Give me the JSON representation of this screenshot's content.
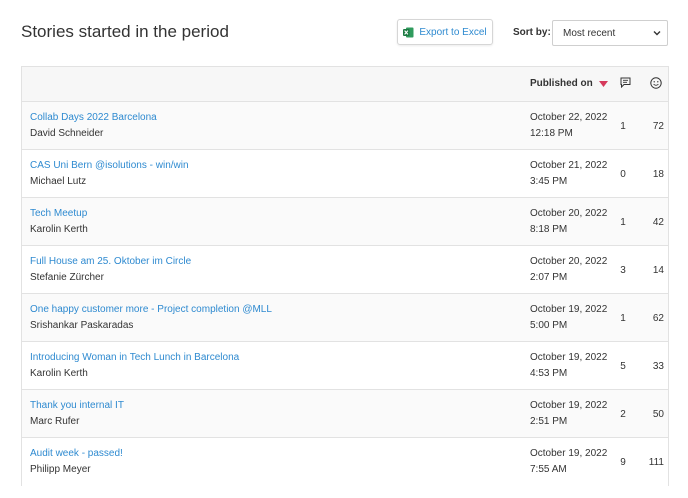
{
  "header": {
    "title": "Stories started in the period",
    "export_label": "Export to Excel",
    "sort_label": "Sort by:",
    "sort_selected": "Most recent"
  },
  "table": {
    "col_published": "Published on",
    "rows": [
      {
        "title": "Collab Days 2022 Barcelona",
        "author": "David Schneider",
        "date": "October 22, 2022",
        "time": "12:18 PM",
        "comments": "1",
        "reactions": "72"
      },
      {
        "title": "CAS Uni Bern @isolutions - win/win",
        "author": "Michael Lutz",
        "date": "October 21, 2022",
        "time": "3:45 PM",
        "comments": "0",
        "reactions": "18"
      },
      {
        "title": "Tech Meetup",
        "author": "Karolin Kerth",
        "date": "October 20, 2022",
        "time": "8:18 PM",
        "comments": "1",
        "reactions": "42"
      },
      {
        "title": "Full House am 25. Oktober im Circle",
        "author": "Stefanie Zürcher",
        "date": "October 20, 2022",
        "time": "2:07 PM",
        "comments": "3",
        "reactions": "14"
      },
      {
        "title": "One happy customer more - Project completion @MLL",
        "author": "Srishankar Paskaradas",
        "date": "October 19, 2022",
        "time": "5:00 PM",
        "comments": "1",
        "reactions": "62"
      },
      {
        "title": "Introducing Woman in Tech Lunch in Barcelona",
        "author": "Karolin Kerth",
        "date": "October 19, 2022",
        "time": "4:53 PM",
        "comments": "5",
        "reactions": "33"
      },
      {
        "title": "Thank you internal IT",
        "author": "Marc Rufer",
        "date": "October 19, 2022",
        "time": "2:51 PM",
        "comments": "2",
        "reactions": "50"
      },
      {
        "title": "Audit week - passed!",
        "author": "Philipp Meyer",
        "date": "October 19, 2022",
        "time": "7:55 AM",
        "comments": "9",
        "reactions": "111"
      }
    ]
  },
  "icons": {
    "export": "excel-icon",
    "sort_select": "chevron-down-icon",
    "sort_direction": "sort-desc-arrow-icon",
    "comments": "comment-icon",
    "reactions": "smiley-icon"
  },
  "colors": {
    "link": "#2e8ad0",
    "sort_arrow": "#d63a5c",
    "excel_green": "#1d7a43"
  }
}
